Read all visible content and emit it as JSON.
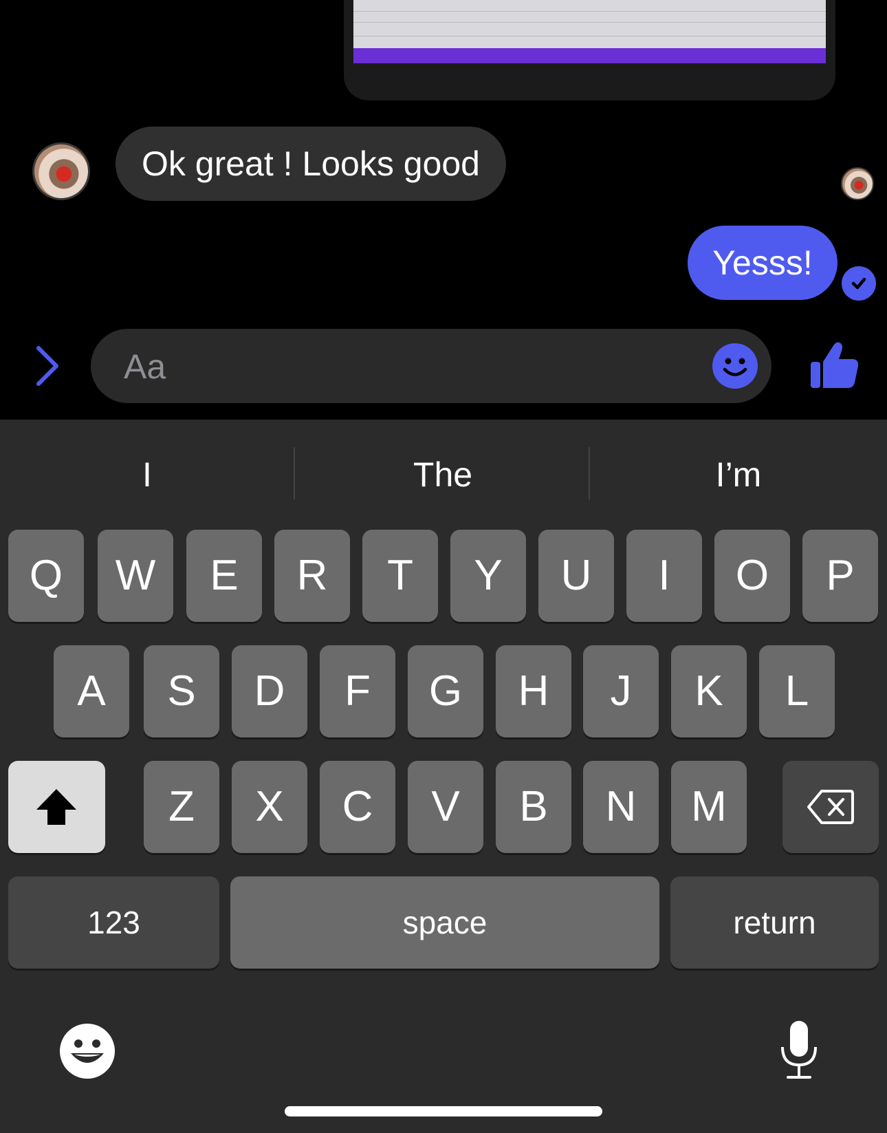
{
  "chat": {
    "incoming_message": "Ok great ! Looks good",
    "outgoing_message": "Yesss!"
  },
  "composer": {
    "placeholder": "Aa"
  },
  "keyboard": {
    "suggestions": [
      "I",
      "The",
      "I’m"
    ],
    "row1": [
      "Q",
      "W",
      "E",
      "R",
      "T",
      "Y",
      "U",
      "I",
      "O",
      "P"
    ],
    "row2": [
      "A",
      "S",
      "D",
      "F",
      "G",
      "H",
      "J",
      "K",
      "L"
    ],
    "row3": [
      "Z",
      "X",
      "C",
      "V",
      "B",
      "N",
      "M"
    ],
    "numbers_label": "123",
    "space_label": "space",
    "return_label": "return"
  },
  "colors": {
    "accent": "#4f5bef",
    "bubble_incoming": "#303030",
    "keyboard_bg": "#2b2b2b",
    "key": "#6b6b6b",
    "key_dark": "#454545"
  },
  "icons": [
    "chevron-right-icon",
    "smiley-icon",
    "thumbs-up-icon",
    "checkmark-icon",
    "shift-arrow-icon",
    "backspace-icon",
    "emoji-keyboard-icon",
    "microphone-icon"
  ]
}
